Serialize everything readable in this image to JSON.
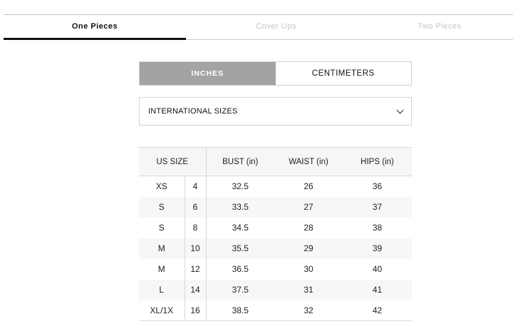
{
  "tabs": [
    {
      "label": "One Pieces",
      "active": true
    },
    {
      "label": "Cover Ups",
      "active": false
    },
    {
      "label": "Two Pieces",
      "active": false
    }
  ],
  "units": {
    "inches": "INCHES",
    "centimeters": "CENTIMETERS",
    "selected": "inches"
  },
  "size_system": {
    "selected": "INTERNATIONAL SIZES"
  },
  "table": {
    "headers": {
      "us_size": "US SIZE",
      "bust": "BUST (in)",
      "waist": "WAIST (in)",
      "hips": "HIPS (in)"
    },
    "rows": [
      {
        "size": "XS",
        "num": "4",
        "bust": "32.5",
        "waist": "26",
        "hips": "36"
      },
      {
        "size": "S",
        "num": "6",
        "bust": "33.5",
        "waist": "27",
        "hips": "37"
      },
      {
        "size": "S",
        "num": "8",
        "bust": "34.5",
        "waist": "28",
        "hips": "38"
      },
      {
        "size": "M",
        "num": "10",
        "bust": "35.5",
        "waist": "29",
        "hips": "39"
      },
      {
        "size": "M",
        "num": "12",
        "bust": "36.5",
        "waist": "30",
        "hips": "40"
      },
      {
        "size": "L",
        "num": "14",
        "bust": "37.5",
        "waist": "31",
        "hips": "41"
      },
      {
        "size": "XL/1X",
        "num": "16",
        "bust": "38.5",
        "waist": "32",
        "hips": "42"
      }
    ]
  }
}
